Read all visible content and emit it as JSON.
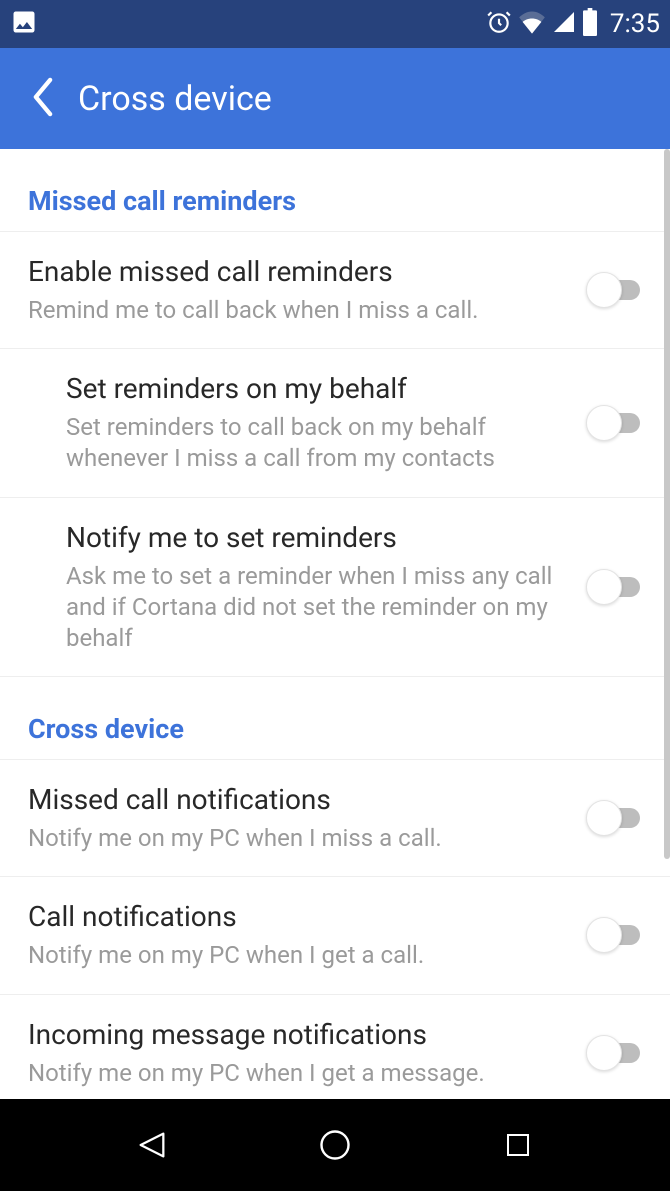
{
  "status": {
    "time": "7:35"
  },
  "header": {
    "title": "Cross device"
  },
  "sections": [
    {
      "header": "Missed call reminders",
      "items": [
        {
          "title": "Enable missed call reminders",
          "desc": "Remind me to call back when I miss a call.",
          "indented": false,
          "on": false
        },
        {
          "title": "Set reminders on my behalf",
          "desc": "Set reminders to call back on my behalf whenever I miss a call from my contacts",
          "indented": true,
          "on": false
        },
        {
          "title": "Notify me to set reminders",
          "desc": "Ask me to set a reminder when I miss any call and if Cortana did not set the reminder on my behalf",
          "indented": true,
          "on": false
        }
      ]
    },
    {
      "header": "Cross device",
      "items": [
        {
          "title": "Missed call notifications",
          "desc": "Notify me on my PC when I miss a call.",
          "indented": false,
          "on": false
        },
        {
          "title": "Call notifications",
          "desc": "Notify me on my PC when I get a call.",
          "indented": false,
          "on": false
        },
        {
          "title": "Incoming message notifications",
          "desc": "Notify me on my PC when I get a message.",
          "indented": false,
          "on": false
        }
      ]
    }
  ]
}
